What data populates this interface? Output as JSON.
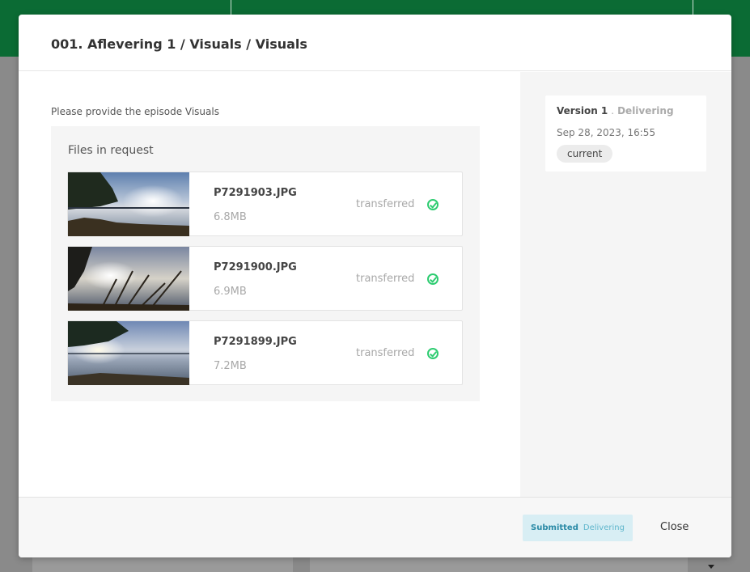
{
  "modal": {
    "title": "001. Aflevering 1 / Visuals / Visuals",
    "instruction": "Please provide the episode Visuals",
    "files_heading": "Files in request",
    "files": [
      {
        "name": "P7291903.JPG",
        "size": "6.8MB",
        "status": "transferred",
        "status_icon": "check-circle-icon"
      },
      {
        "name": "P7291900.JPG",
        "size": "6.9MB",
        "status": "transferred",
        "status_icon": "check-circle-icon"
      },
      {
        "name": "P7291899.JPG",
        "size": "7.2MB",
        "status": "transferred",
        "status_icon": "check-circle-icon"
      }
    ],
    "version": {
      "label": "Version 1",
      "separator": ".",
      "state": "Delivering",
      "date": "Sep 28, 2023, 16:55",
      "tag": "current"
    },
    "footer": {
      "badge_submitted": "Submitted",
      "badge_state": "Delivering",
      "close_label": "Close"
    }
  },
  "colors": {
    "header_green": "#0b6b34",
    "success": "#2ecc71",
    "badge_bg": "#d8eef4",
    "badge_text": "#2a8aa6"
  }
}
